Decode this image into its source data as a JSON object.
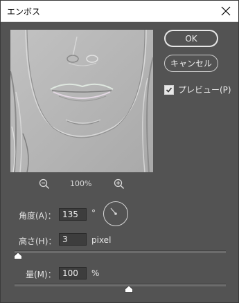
{
  "window": {
    "title": "エンボス"
  },
  "buttons": {
    "ok_label": "OK",
    "cancel_label": "キャンセル"
  },
  "preview_checkbox": {
    "label": "プレビュー(P)",
    "checked": true
  },
  "zoom": {
    "value": "100%"
  },
  "angle": {
    "label": "角度(A)：",
    "value": "135",
    "unit": "°"
  },
  "height": {
    "label": "高さ(H)：",
    "value": "3",
    "unit": "pixel",
    "slider_fraction": 0.015
  },
  "amount": {
    "label": "量(M)：",
    "value": "100",
    "unit": "%",
    "slider_fraction": 0.54
  },
  "colors": {
    "dialog_bg": "#535353",
    "field_bg": "#3d3d3d",
    "text": "#e4e4e4"
  }
}
